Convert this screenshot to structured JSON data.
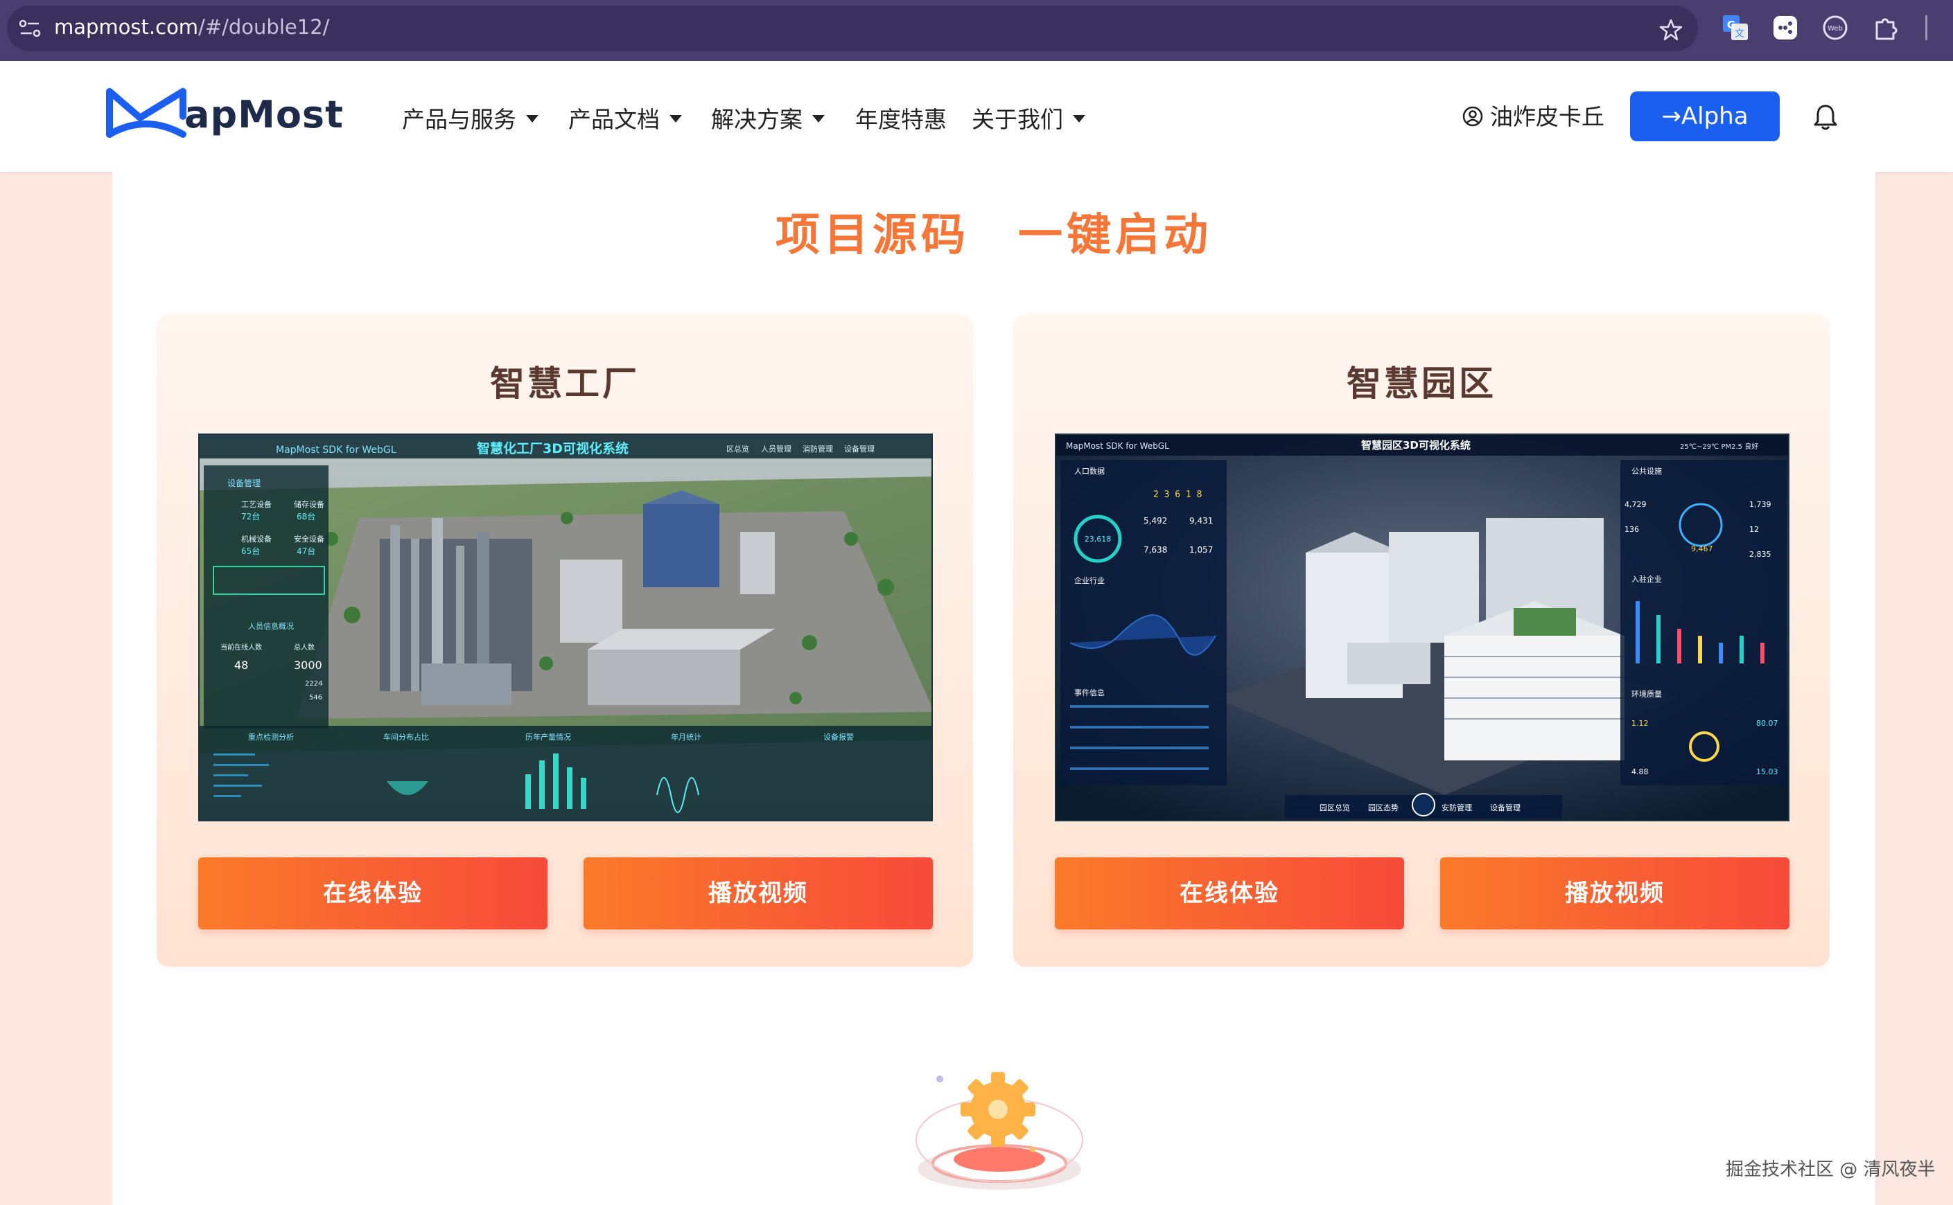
{
  "browser": {
    "url_host": "mapmost.com",
    "url_path": "/#/double12/",
    "icons": [
      "site-info-icon",
      "bookmark-star-icon",
      "translate-extension-icon",
      "game-extension-icon",
      "web-extension-icon",
      "extensions-puzzle-icon"
    ]
  },
  "header": {
    "logo_text": "apMost",
    "nav": [
      {
        "label": "产品与服务",
        "has_dropdown": true
      },
      {
        "label": "产品文档",
        "has_dropdown": true
      },
      {
        "label": "解决方案",
        "has_dropdown": true
      },
      {
        "label": "年度特惠",
        "has_dropdown": false
      },
      {
        "label": "关于我们",
        "has_dropdown": true
      }
    ],
    "user_name": "油炸皮卡丘",
    "alpha_button": "→Alpha",
    "bell": "bell-icon"
  },
  "main": {
    "section_title": "项目源码　一键启动",
    "cards": [
      {
        "title": "智慧工厂",
        "image_title": "智慧化工厂3D可视化系统",
        "image_brand": "MapMost SDK for WebGL",
        "image_tabs": [
          "区总览",
          "人员管理",
          "消防管理",
          "设备管理"
        ],
        "image_labels": {
          "equipment_panel": "设备管理",
          "process_equipment": "工艺设备",
          "process_value": "72台",
          "storage_equipment": "储存设备",
          "storage_value": "68台",
          "mechanical_equipment": "机械设备",
          "mechanical_value": "65台",
          "safety_equipment": "安全设备",
          "safety_value": "47台",
          "personnel_panel": "人员信息概况",
          "personnel_current": "当前在线人数",
          "personnel_total": "总人数",
          "personnel_current_value": "48",
          "personnel_total_value": "3000",
          "metric_a": "2224",
          "metric_b": "546",
          "bottom_a": "重点检测分析",
          "bottom_b": "车间分布占比",
          "bottom_c": "历年产量情况",
          "bottom_d": "年月统计",
          "bottom_e": "设备报警"
        },
        "primary_button": "在线体验",
        "secondary_button": "播放视频"
      },
      {
        "title": "智慧园区",
        "image_title": "智慧园区3D可视化系统",
        "image_brand": "MapMost SDK for WebGL",
        "image_weather": "25℃~29℃   PM2.5 良好",
        "image_labels": {
          "population": "人口数据",
          "population_total": "23,618",
          "pop_a": "5,492",
          "pop_b": "9,431",
          "pop_c": "7,638",
          "pop_d": "1,057",
          "counter": "2 3 6 1 8",
          "public": "公共设施",
          "pub_a": "4,729",
          "pub_b": "1,739",
          "pub_c": "136",
          "pub_d": "12",
          "pub_e": "9,467",
          "pub_f": "2,835",
          "industry": "企业行业",
          "enterprises": "入驻企业",
          "events": "事件信息",
          "environment": "环境质量",
          "env_a": "1.12",
          "env_b": "80.07",
          "env_c": "4.88",
          "env_d": "15.03",
          "nav_a": "园区总览",
          "nav_b": "园区态势",
          "nav_c": "安防管理",
          "nav_d": "设备管理"
        },
        "primary_button": "在线体验",
        "secondary_button": "播放视频"
      }
    ]
  },
  "watermark": "掘金技术社区 @ 清风夜半",
  "colors": {
    "accent_orange": "#f57637",
    "button_gradient_start": "#fa7a2a",
    "button_gradient_end": "#f74a3a",
    "alpha_blue": "#1a5ff0",
    "browser_purple": "#4a3d70"
  }
}
